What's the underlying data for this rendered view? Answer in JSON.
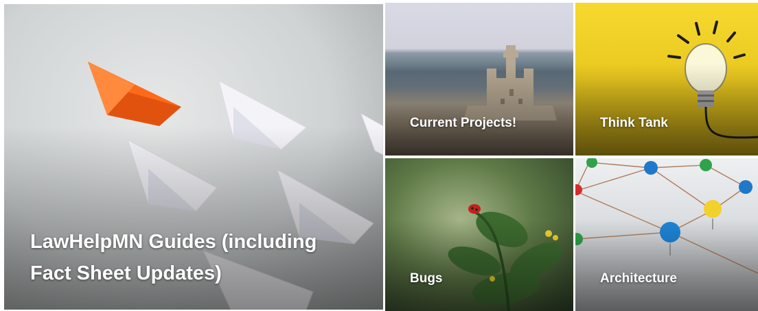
{
  "tiles": [
    {
      "title": "LawHelpMN Guides (including Fact Sheet Updates)",
      "image": "paper-boats-image"
    },
    {
      "title": "Current Projects!",
      "image": "sandcastle-beach-image"
    },
    {
      "title": "Think Tank",
      "image": "lightbulb-image"
    },
    {
      "title": "Bugs",
      "image": "ladybug-plant-image"
    },
    {
      "title": "Architecture",
      "image": "network-pins-image"
    }
  ],
  "colors": {
    "title_text": "#ffffff",
    "think_tank_yellow": "#f6d92f",
    "lead_boat_orange": "#ff6a1a"
  }
}
